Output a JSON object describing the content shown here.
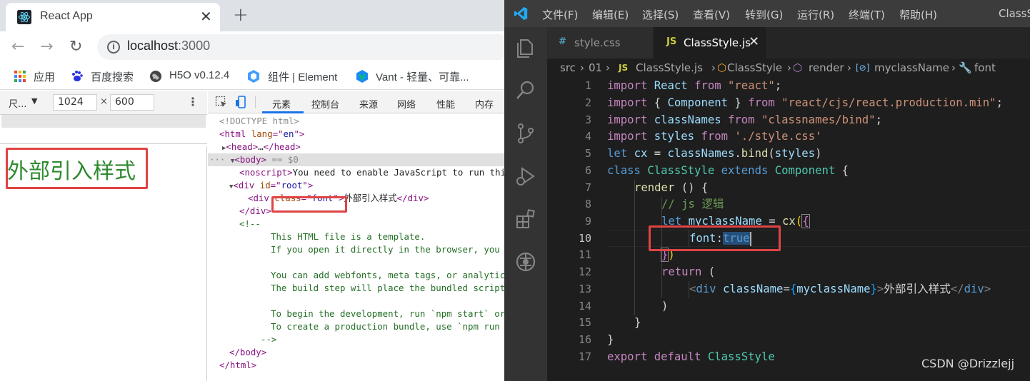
{
  "browser": {
    "tab_title": "React App",
    "url_host": "localhost",
    "url_port": ":3000",
    "bookmarks": [
      "应用",
      "百度搜索",
      "H5O v0.12.4",
      "组件 | Element",
      "Vant - 轻量、可靠..."
    ],
    "device_toolbar": {
      "label": "尺...",
      "width": "1024",
      "height": "600",
      "times": "×"
    },
    "page_text": "外部引入样式",
    "devtools_tabs": [
      "元素",
      "控制台",
      "来源",
      "网络",
      "性能",
      "内存"
    ],
    "dom": {
      "doctype": "<!DOCTYPE html>",
      "html_open": [
        "<html ",
        "lang",
        "=\"",
        "en",
        "\">"
      ],
      "head": [
        "▶",
        "<head>",
        "…",
        "</head>"
      ],
      "body_open": [
        "···",
        "▼",
        "<body>",
        " == $0"
      ],
      "noscript": [
        "<noscript>",
        "You need to enable JavaScript to run thi"
      ],
      "root_div": [
        "▼",
        "<div ",
        "id",
        "=\"",
        "root",
        "\">"
      ],
      "font_div": [
        "<div ",
        "class",
        "=\"",
        "font",
        "\">",
        "外部引入样式",
        "</div>"
      ],
      "div_close": "</div>",
      "comment_open": "<!--",
      "comment_lines": [
        "This HTML file is a template.",
        "If you open it directly in the browser, you",
        "",
        "You can add webfonts, meta tags, or analytic",
        "The build step will place the bundled script",
        "",
        "To begin the development, run `npm start` or",
        "To create a production bundle, use `npm run "
      ],
      "comment_close": "-->",
      "body_close": "</body>",
      "html_close": "</html>"
    }
  },
  "vscode": {
    "menu": [
      "文件(F)",
      "编辑(E)",
      "选择(S)",
      "查看(V)",
      "转到(G)",
      "运行(R)",
      "终端(T)",
      "帮助(H)"
    ],
    "window_title": "ClassSt",
    "tabs": [
      {
        "icon": "#",
        "label": "style.css"
      },
      {
        "icon": "JS",
        "label": "ClassStyle.js",
        "close": "✕"
      }
    ],
    "breadcrumb": [
      "src",
      "01",
      "JS",
      "ClassStyle.js",
      "ClassStyle",
      "render",
      "[⊘]",
      "myclassName",
      "font"
    ],
    "line_numbers": [
      "1",
      "2",
      "3",
      "4",
      "5",
      "6",
      "7",
      "8",
      "9",
      "10",
      "11",
      "12",
      "13",
      "14",
      "15",
      "16",
      "17"
    ],
    "active_line": "10",
    "code": {
      "l1": [
        "import",
        " React ",
        "from",
        " ",
        "\"react\"",
        ";"
      ],
      "l2": [
        "import",
        " { ",
        "Component",
        " } ",
        "from",
        " ",
        "\"react/cjs/react.production.min\"",
        ";"
      ],
      "l3": [
        "import",
        " ",
        "classNames",
        " ",
        "from",
        " ",
        "\"classnames/bind\"",
        ";"
      ],
      "l4": [
        "import",
        " ",
        "styles",
        " ",
        "from",
        " ",
        "'./style.css'"
      ],
      "l5": [
        "let",
        " ",
        "cx",
        " = ",
        "classNames",
        ".",
        "bind",
        "(",
        "styles",
        ")"
      ],
      "l6": [
        "class",
        " ",
        "ClassStyle",
        " ",
        "extends",
        " ",
        "Component",
        " {"
      ],
      "l7": [
        "render",
        " () {"
      ],
      "l8": [
        "// js 逻辑"
      ],
      "l9": [
        "let",
        " ",
        "myclassName",
        " = ",
        "cx",
        "(",
        "{"
      ],
      "l10": [
        "font",
        ":",
        "true"
      ],
      "l11": [
        "}",
        ")"
      ],
      "l12": [
        "return",
        " ("
      ],
      "l13": [
        "<",
        "div",
        " ",
        "className",
        "=",
        "{",
        "myclassName",
        "}",
        ">",
        "外部引入样式",
        "</",
        "div",
        ">"
      ],
      "l14": [
        ")"
      ],
      "l15": [
        "}"
      ],
      "l16": [
        "}"
      ],
      "l17": [
        "export",
        " ",
        "default",
        " ",
        "ClassStyle"
      ]
    }
  },
  "watermark": "CSDN @Drizzlejj"
}
